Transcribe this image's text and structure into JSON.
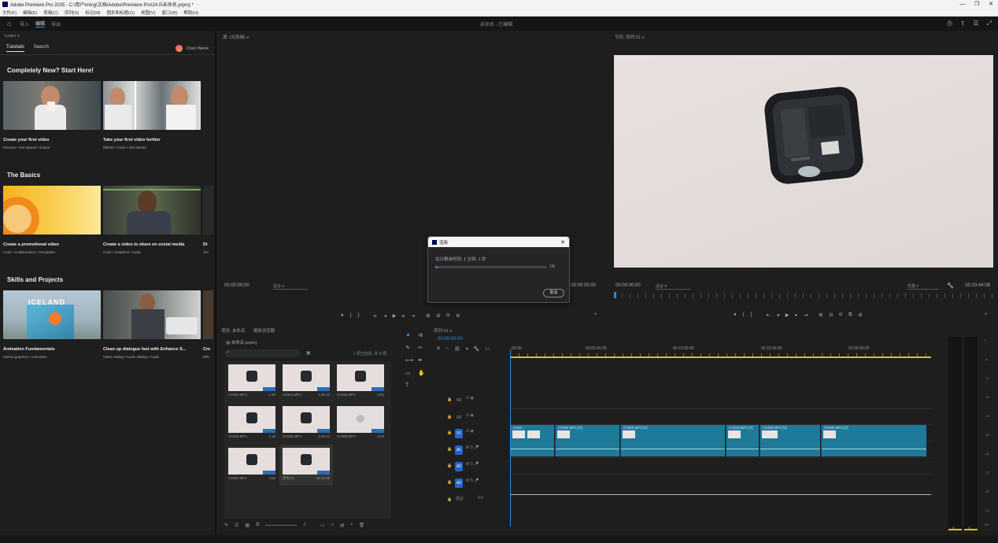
{
  "window": {
    "title": "Adobe Premiere Pro 2025 - C:\\用户\\ming\\文档\\Adobe\\Premiere Pro\\24.0\\未命名.prproj *",
    "controls": [
      "—",
      "❐",
      "✕"
    ]
  },
  "menu": [
    "文件(F)",
    "编辑(E)",
    "剪辑(C)",
    "序列(S)",
    "标记(M)",
    "图形和标题(G)",
    "视图(V)",
    "窗口(W)",
    "帮助(H)"
  ],
  "header": {
    "workspaces": [
      "导入",
      "编辑",
      "导出"
    ],
    "active_workspace": "编辑",
    "center_title": "未命名 - 已编辑"
  },
  "learn": {
    "panel_label": "Learn",
    "tabs": [
      "Tutorials",
      "Search"
    ],
    "active_tab": "Tutorials",
    "user": "Chen Wenk",
    "sections": [
      {
        "title": "Completely New? Start Here!",
        "cards": [
          {
            "title": "Create your first video",
            "sub": "Preview • Get started • Export"
          },
          {
            "title": "Take your first video further",
            "sub": "Effects • Color • Get started"
          }
        ]
      },
      {
        "title": "The Basics",
        "cards": [
          {
            "title": "Create a promotional video",
            "sub": "Color • Collaboration • Templates"
          },
          {
            "title": "Create a video to share on social media",
            "sub": "Color • Graphics • Audio"
          },
          {
            "title": "Di",
            "sub": "Tex"
          }
        ]
      },
      {
        "title": "Skills and Projects",
        "cards": [
          {
            "title": "Animation Fundamentals",
            "sub": "Motion graphics • Animation",
            "overlay": "ICELAND"
          },
          {
            "title": "Clean up dialogue fast with Enhance S...",
            "sub": "Video editing • Audio editing • Audio"
          },
          {
            "title": "Cre",
            "sub": "Effe"
          }
        ]
      }
    ]
  },
  "source": {
    "panel_label": "源: (无剪辑)",
    "timecode_in": "00:00:00:00",
    "timecode_out": "00:00:00:00",
    "fit": "适合"
  },
  "program": {
    "panel_label": "节目: 序列 01",
    "timecode_in": "00:00:00:00",
    "timecode_out": "00:23:44:08",
    "fit": "适合",
    "quality": "完整"
  },
  "dialog": {
    "title": "渲染",
    "message": "估计剩余时间: 1 分钟, 1 秒",
    "progress_pct": 1,
    "progress_label": "1%",
    "cancel": "取消"
  },
  "project": {
    "tabs": [
      "项目: 未命名",
      "媒体浏览器"
    ],
    "bin": "未命名.prproj",
    "count": "1 项已选择, 共 8 项",
    "clips": [
      {
        "name": "C0491.MP4",
        "dur": "1:30"
      },
      {
        "name": "C0492.MP4",
        "dur": "1:40:10"
      },
      {
        "name": "C0493.MP4",
        "dur": "2:04"
      },
      {
        "name": "C0494.MP4",
        "dur": "1:19"
      },
      {
        "name": "C0495.MP4",
        "dur": "1:40:10"
      },
      {
        "name": "C0496.MP4",
        "dur": "2:04"
      },
      {
        "name": "C0497.MP4",
        "dur": "1:52"
      },
      {
        "name": "序列 01",
        "dur": "23:44:08"
      }
    ]
  },
  "timeline": {
    "panel_label": "序列 01",
    "timecode": "00:00:00:00",
    "ruler": [
      ":00:00",
      "00:05:00:00",
      "00:10:00:00",
      "00:15:00:00",
      "00:20:00:00"
    ],
    "tracks_video": [
      "V3",
      "V2",
      "V1"
    ],
    "tracks_audio": [
      "A1",
      "A2",
      "A3"
    ],
    "mix_label": "混合",
    "mix_value": "0.0",
    "video_clips": [
      "C049...",
      "C0492.MP4 [V]",
      "C0493.MP4 [V]",
      "C0494.MP4 [V]",
      "C0495.MP4 [V]",
      "C0496.MP4 [V]"
    ]
  },
  "meter": {
    "scale": [
      "0",
      "-6",
      "-12",
      "-18",
      "-24",
      "-30",
      "-36",
      "-42",
      "-48",
      "-54",
      "dB"
    ],
    "channels": [
      "S",
      "S"
    ]
  }
}
